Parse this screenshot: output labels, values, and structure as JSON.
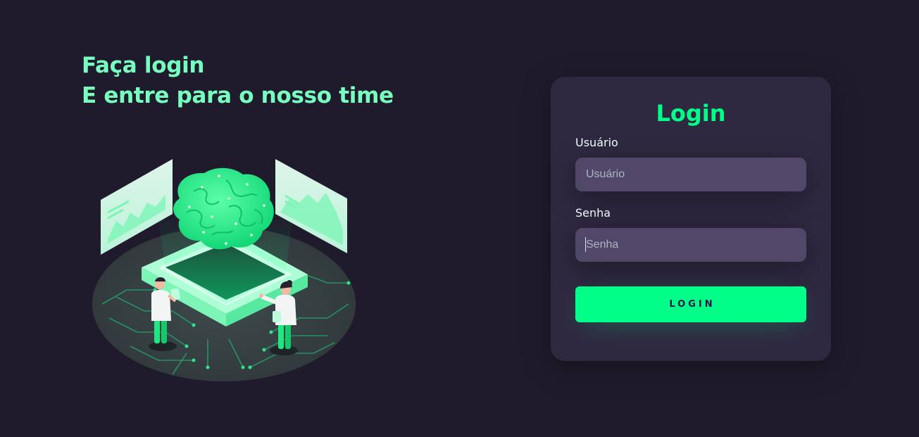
{
  "headline": {
    "line1": "Faça login",
    "line2": "E entre para o nosso time"
  },
  "illustration": {
    "icon": "brain-data-team-illustration"
  },
  "login_card": {
    "title": "Login",
    "username": {
      "label": "Usuário",
      "placeholder": "Usuário",
      "value": ""
    },
    "password": {
      "label": "Senha",
      "placeholder": "Senha",
      "value": ""
    },
    "submit_label": "Login"
  },
  "colors": {
    "background": "#201b2c",
    "accent": "#00ff88",
    "headline": "#77ffc0",
    "card": "#2f2841",
    "input": "#514869"
  }
}
